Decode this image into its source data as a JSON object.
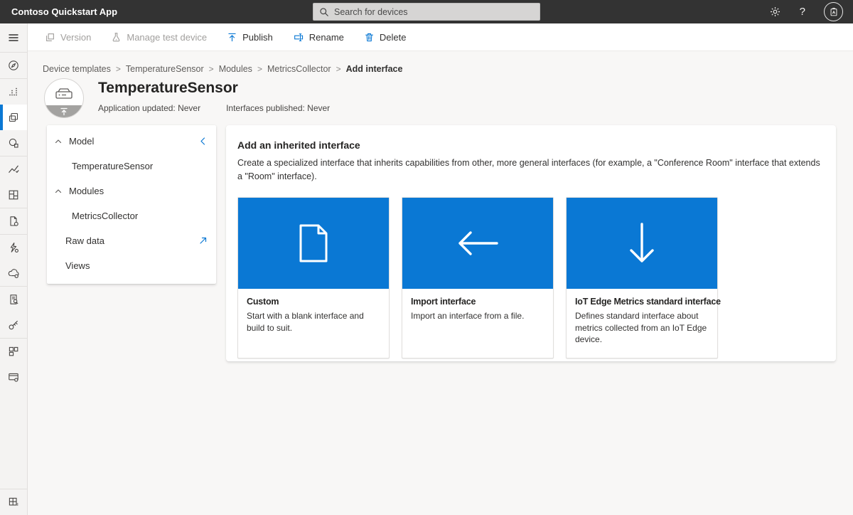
{
  "topbar": {
    "app_title": "Contoso Quickstart App",
    "search_placeholder": "Search for devices",
    "help_label": "?",
    "icons": [
      "search-icon",
      "settings-gear-icon",
      "help-icon",
      "account-avatar-icon"
    ]
  },
  "toolbar": {
    "items": [
      {
        "label": "Version",
        "icon": "version-icon",
        "disabled": true
      },
      {
        "label": "Manage test device",
        "icon": "test-device-flask-icon",
        "disabled": true
      },
      {
        "label": "Publish",
        "icon": "publish-up-arrow-icon",
        "disabled": false
      },
      {
        "label": "Rename",
        "icon": "rename-icon",
        "disabled": false
      },
      {
        "label": "Delete",
        "icon": "delete-trash-icon",
        "disabled": false
      }
    ]
  },
  "breadcrumb": {
    "separator": ">",
    "items": [
      "Device templates",
      "TemperatureSensor",
      "Modules",
      "MetricsCollector",
      "Add interface"
    ]
  },
  "header": {
    "title": "TemperatureSensor",
    "meta": [
      "Application updated: Never",
      "Interfaces published: Never"
    ],
    "avatar_icons": [
      "iot-device-icon",
      "publish-up-arrow-icon"
    ]
  },
  "sidebar": {
    "selected": "device-templates",
    "items": [
      {
        "name": "menu-icon"
      },
      {
        "name": "get-started-compass-icon"
      },
      {
        "name": "devices-icon"
      },
      {
        "name": "device-templates-icon"
      },
      {
        "name": "device-groups-icon"
      },
      {
        "name": "analytics-chart-icon"
      },
      {
        "name": "dashboards-icon"
      },
      {
        "name": "jobs-document-icon"
      },
      {
        "name": "rules-lightning-icon"
      },
      {
        "name": "data-export-cloud-icon"
      },
      {
        "name": "audit-logs-icon"
      },
      {
        "name": "permissions-key-icon"
      },
      {
        "name": "customization-layout-icon"
      },
      {
        "name": "application-settings-icon"
      },
      {
        "name": "my-apps-grid-icon"
      }
    ]
  },
  "tree": {
    "rows": [
      {
        "label": "Model",
        "type": "section"
      },
      {
        "label": "TemperatureSensor",
        "type": "child"
      },
      {
        "label": "Modules",
        "type": "section"
      },
      {
        "label": "MetricsCollector",
        "type": "child"
      },
      {
        "label": "Raw data",
        "type": "leaf-expand"
      },
      {
        "label": "Views",
        "type": "leaf"
      }
    ]
  },
  "main": {
    "title": "Add an inherited interface",
    "description": "Create a specialized interface that inherits capabilities from other, more general interfaces (for example, a \"Conference Room\" interface that extends a \"Room\" interface).",
    "cards": [
      {
        "title": "Custom",
        "description": "Start with a blank interface and build to suit.",
        "icon": "blank-document-icon"
      },
      {
        "title": "Import interface",
        "description": "Import an interface from a file.",
        "icon": "arrow-left-icon"
      },
      {
        "title": "IoT Edge Metrics standard interface",
        "description": "Defines standard interface about metrics collected from an IoT Edge device.",
        "icon": "arrow-down-icon"
      }
    ]
  },
  "colors": {
    "topbar_bg": "#333333",
    "accent_blue": "#0a78d4",
    "card_blue": "#0a78d4",
    "content_bg": "#f8f7f6",
    "sidebar_bg": "#f4f3f2"
  }
}
